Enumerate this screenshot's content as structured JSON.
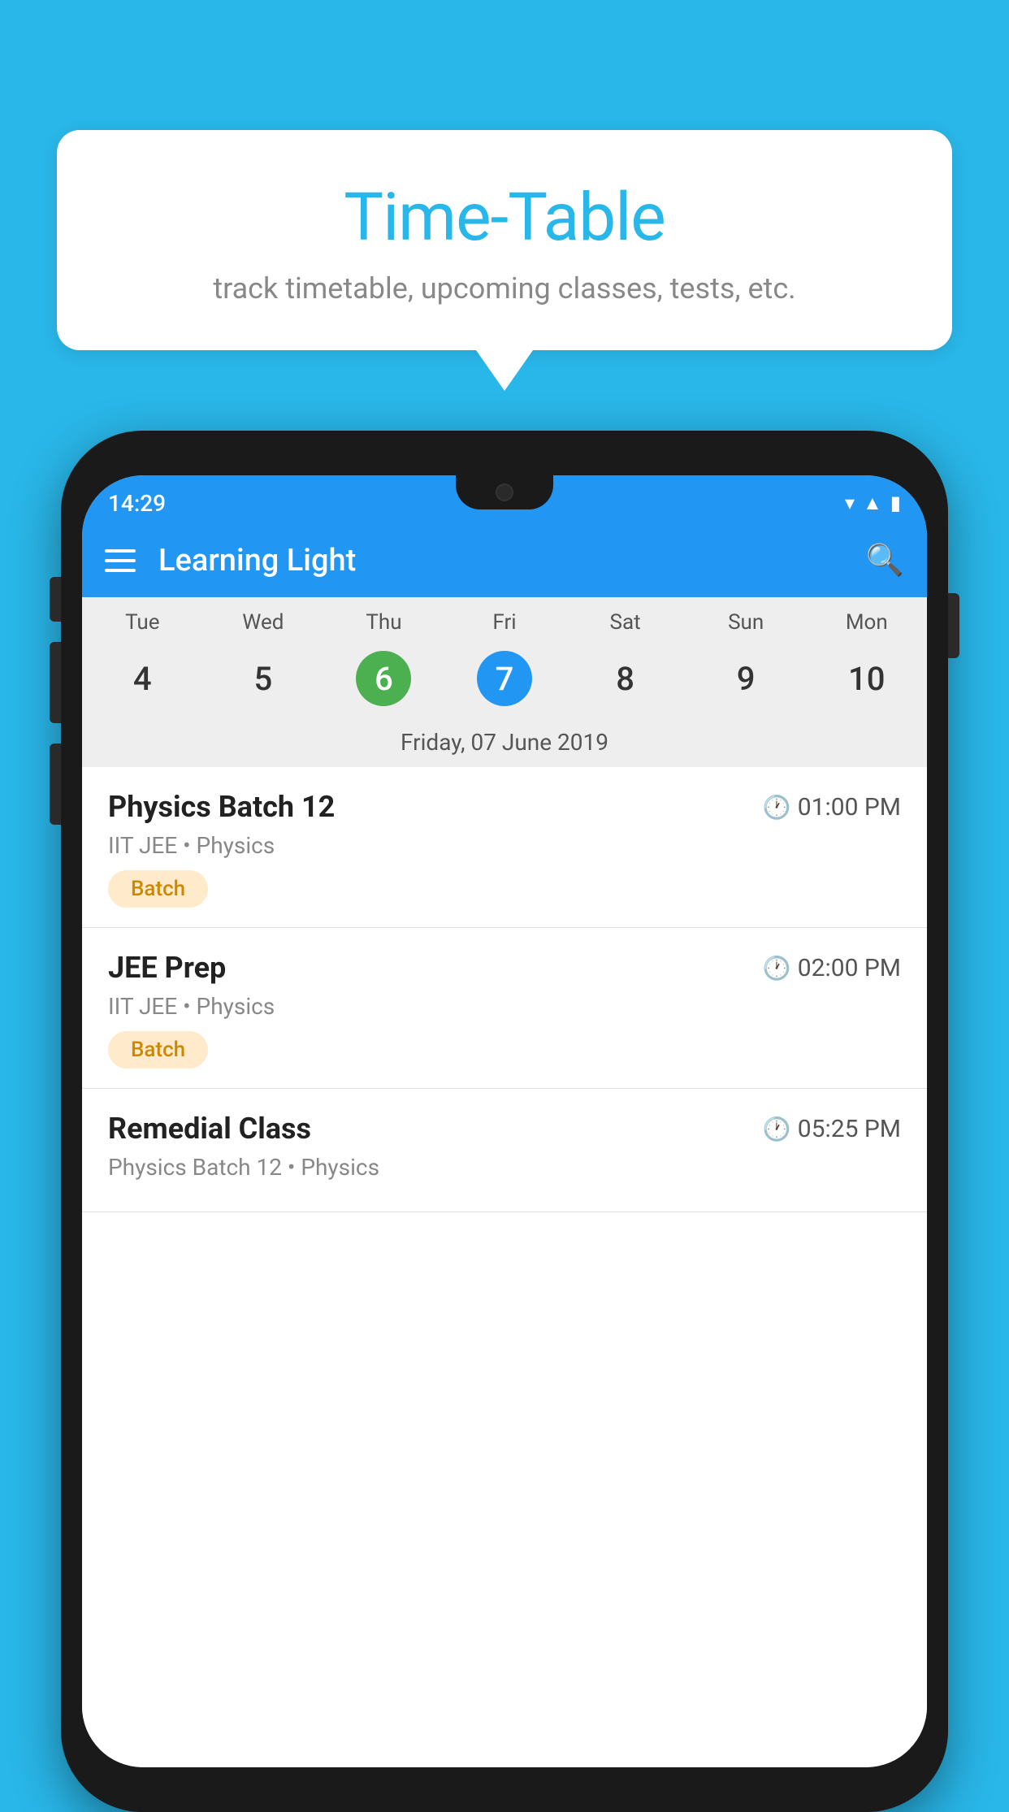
{
  "page": {
    "background_color": "#29b6e8"
  },
  "speech_bubble": {
    "title": "Time-Table",
    "subtitle": "track timetable, upcoming classes, tests, etc."
  },
  "phone": {
    "status_bar": {
      "time": "14:29"
    },
    "app_bar": {
      "title": "Learning Light",
      "menu_icon_label": "menu",
      "search_icon_label": "search"
    },
    "calendar": {
      "weekdays": [
        "Tue",
        "Wed",
        "Thu",
        "Fri",
        "Sat",
        "Sun",
        "Mon"
      ],
      "dates": [
        {
          "day": "4",
          "state": "normal"
        },
        {
          "day": "5",
          "state": "normal"
        },
        {
          "day": "6",
          "state": "today"
        },
        {
          "day": "7",
          "state": "selected"
        },
        {
          "day": "8",
          "state": "normal"
        },
        {
          "day": "9",
          "state": "normal"
        },
        {
          "day": "10",
          "state": "normal"
        }
      ],
      "selected_date_label": "Friday, 07 June 2019"
    },
    "schedule": [
      {
        "title": "Physics Batch 12",
        "time": "01:00 PM",
        "meta": "IIT JEE • Physics",
        "tag": "Batch"
      },
      {
        "title": "JEE Prep",
        "time": "02:00 PM",
        "meta": "IIT JEE • Physics",
        "tag": "Batch"
      },
      {
        "title": "Remedial Class",
        "time": "05:25 PM",
        "meta": "Physics Batch 12 • Physics",
        "tag": ""
      }
    ]
  }
}
